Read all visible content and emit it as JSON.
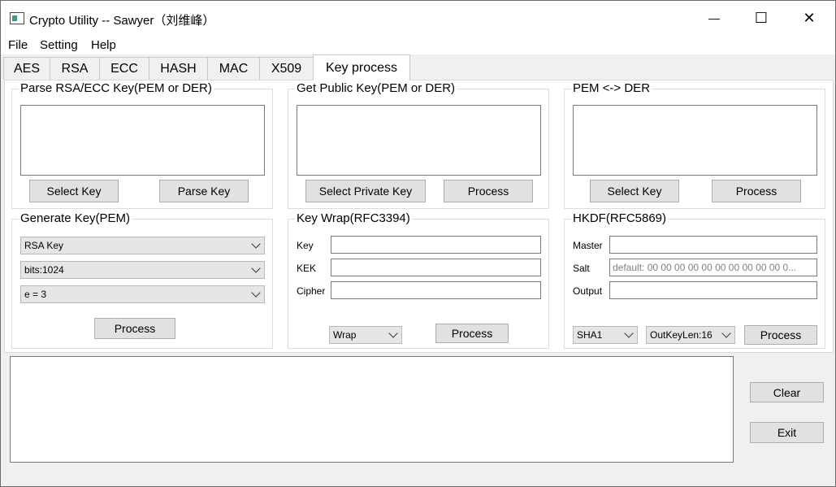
{
  "window": {
    "title": "Crypto Utility -- Sawyer（刘维峰）",
    "minimize": "—",
    "maximize": "☐",
    "close": "✕"
  },
  "menu": [
    "File",
    "Setting",
    "Help"
  ],
  "tabs": [
    "AES",
    "RSA",
    "ECC",
    "HASH",
    "MAC",
    "X509",
    "Key process"
  ],
  "active_tab": "Key process",
  "parse_key": {
    "title": "Parse RSA/ECC Key(PEM or DER)",
    "select_button": "Select Key",
    "parse_button": "Parse Key"
  },
  "get_public_key": {
    "title": "Get Public Key(PEM or DER)",
    "select_button": "Select Private Key",
    "process_button": "Process"
  },
  "pem_der": {
    "title": "PEM <-> DER",
    "select_button": "Select Key",
    "process_button": "Process"
  },
  "generate_key": {
    "title": "Generate Key(PEM)",
    "key_type": "RSA Key",
    "bits": "bits:1024",
    "exponent": "e = 3",
    "process_button": "Process"
  },
  "key_wrap": {
    "title": "Key Wrap(RFC3394)",
    "key_label": "Key",
    "kek_label": "KEK",
    "cipher_label": "Cipher",
    "mode": "Wrap",
    "process_button": "Process"
  },
  "hkdf": {
    "title": "HKDF(RFC5869)",
    "master_label": "Master",
    "salt_label": "Salt",
    "salt_placeholder": "default: 00 00 00 00 00 00 00 00 00 00 0...",
    "output_label": "Output",
    "hash": "SHA1",
    "outkeylen": "OutKeyLen:16",
    "process_button": "Process"
  },
  "bottom": {
    "clear_button": "Clear",
    "exit_button": "Exit"
  }
}
